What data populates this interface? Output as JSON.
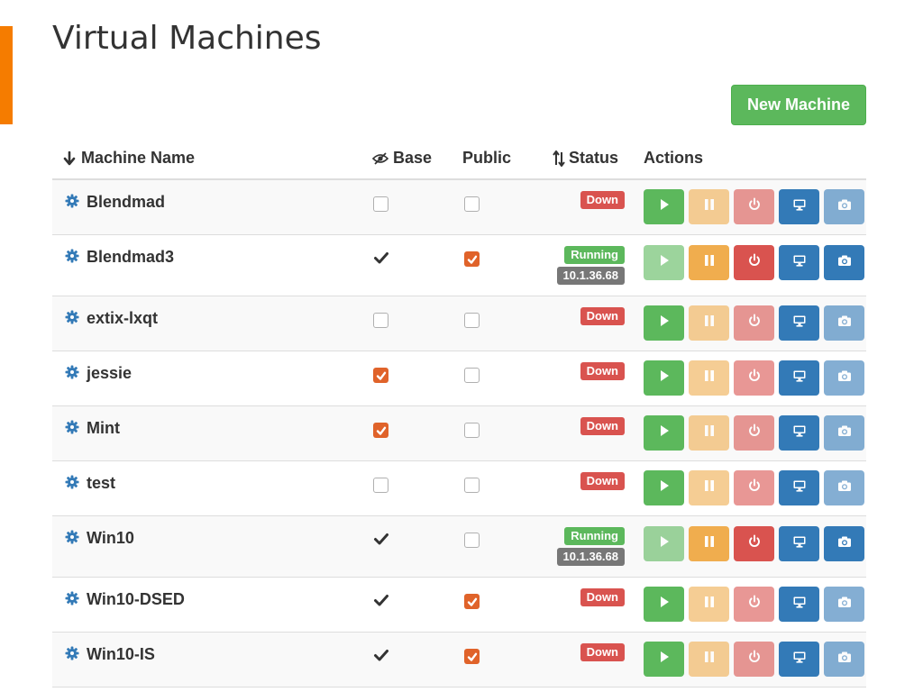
{
  "page": {
    "title": "Virtual Machines",
    "new_button_label": "New Machine",
    "accent_color": "#f57c00"
  },
  "table": {
    "headers": {
      "name": "Machine Name",
      "name_sort_icon": "arrow-down-icon",
      "base": "Base",
      "base_icon": "eye-slash-icon",
      "public": "Public",
      "status": "Status",
      "status_sort_icon": "sort-icon",
      "actions": "Actions"
    },
    "row_icon": "gear-icon",
    "rows": [
      {
        "name": "Blendmad",
        "base": "unchecked",
        "public": "unchecked",
        "status": "Down",
        "ip": ""
      },
      {
        "name": "Blendmad3",
        "base": "checkmark",
        "public": "checked",
        "status": "Running",
        "ip": "10.1.36.68"
      },
      {
        "name": "extix-lxqt",
        "base": "unchecked",
        "public": "unchecked",
        "status": "Down",
        "ip": ""
      },
      {
        "name": "jessie",
        "base": "checked",
        "public": "unchecked",
        "status": "Down",
        "ip": ""
      },
      {
        "name": "Mint",
        "base": "checked",
        "public": "unchecked",
        "status": "Down",
        "ip": ""
      },
      {
        "name": "test",
        "base": "unchecked",
        "public": "unchecked",
        "status": "Down",
        "ip": ""
      },
      {
        "name": "Win10",
        "base": "checkmark",
        "public": "unchecked",
        "status": "Running",
        "ip": "10.1.36.68"
      },
      {
        "name": "Win10-DSED",
        "base": "checkmark",
        "public": "checked",
        "status": "Down",
        "ip": ""
      },
      {
        "name": "Win10-IS",
        "base": "checkmark",
        "public": "checked",
        "status": "Down",
        "ip": ""
      }
    ],
    "action_icons": [
      "play-icon",
      "pause-icon",
      "power-icon",
      "desktop-icon",
      "camera-icon"
    ],
    "colors": {
      "start": "#5cb85c",
      "pause": "#f0ad4e",
      "power": "#d9534f",
      "console": "#337ab7",
      "snapshot": "#337ab7",
      "status_down": "#d9534f",
      "status_running": "#5cb85c",
      "ip_badge": "#777777",
      "checked": "#e0632a"
    }
  }
}
